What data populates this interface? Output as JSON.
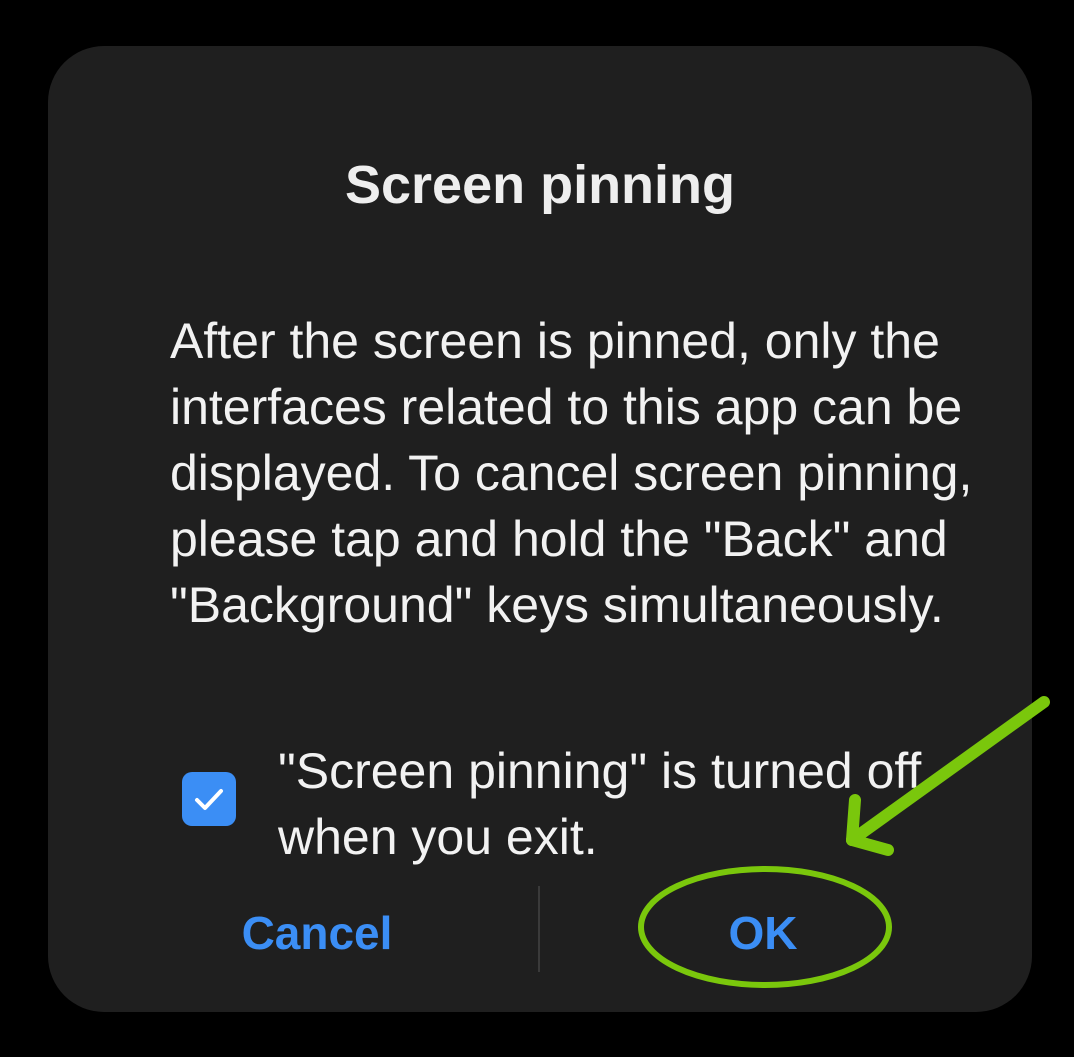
{
  "dialog": {
    "title": "Screen pinning",
    "message": "After the screen is pinned, only the interfaces related to this app can be displayed. To cancel screen pinning, please tap and hold the \"Back\" and \"Background\" keys simultaneously.",
    "checkbox": {
      "label": "\"Screen pinning\" is turned off when you exit.",
      "checked": true
    },
    "buttons": {
      "cancel_label": "Cancel",
      "ok_label": "OK"
    }
  },
  "colors": {
    "background": "#000000",
    "dialog": "#1f1f1f",
    "accent": "#3b8ef5",
    "annotation": "#7ac70c"
  },
  "icons": {
    "checkmark": "check-icon"
  }
}
